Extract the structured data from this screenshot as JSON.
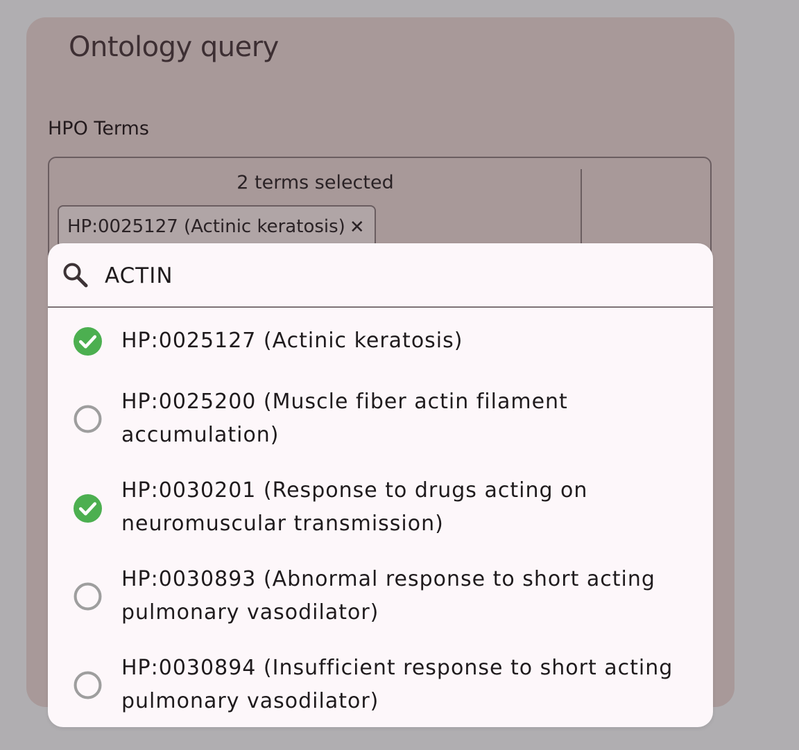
{
  "page": {
    "title": "Ontology query"
  },
  "hpo": {
    "label": "HPO Terms",
    "selected_count": "2 terms selected",
    "chips": [
      {
        "label": "HP:0025127 (Actinic keratosis)",
        "remove_icon": "close-icon"
      }
    ]
  },
  "search": {
    "value": "ACTIN",
    "icon": "search-icon"
  },
  "options": [
    {
      "label": "HP:0025127 (Actinic keratosis)",
      "selected": true
    },
    {
      "label": "HP:0025200 (Muscle fiber actin filament accumulation)",
      "selected": false
    },
    {
      "label": "HP:0030201 (Response to drugs acting on neuromuscular transmission)",
      "selected": true
    },
    {
      "label": "HP:0030893 (Abnormal response to short acting pulmonary vasodilator)",
      "selected": false
    },
    {
      "label": "HP:0030894 (Insufficient response to short acting pulmonary vasodilator)",
      "selected": false
    }
  ],
  "colors": {
    "selected": "#4caf50",
    "unselected": "#9e9e9e",
    "card": "#a89999",
    "dropdown": "#fdf7fa"
  }
}
